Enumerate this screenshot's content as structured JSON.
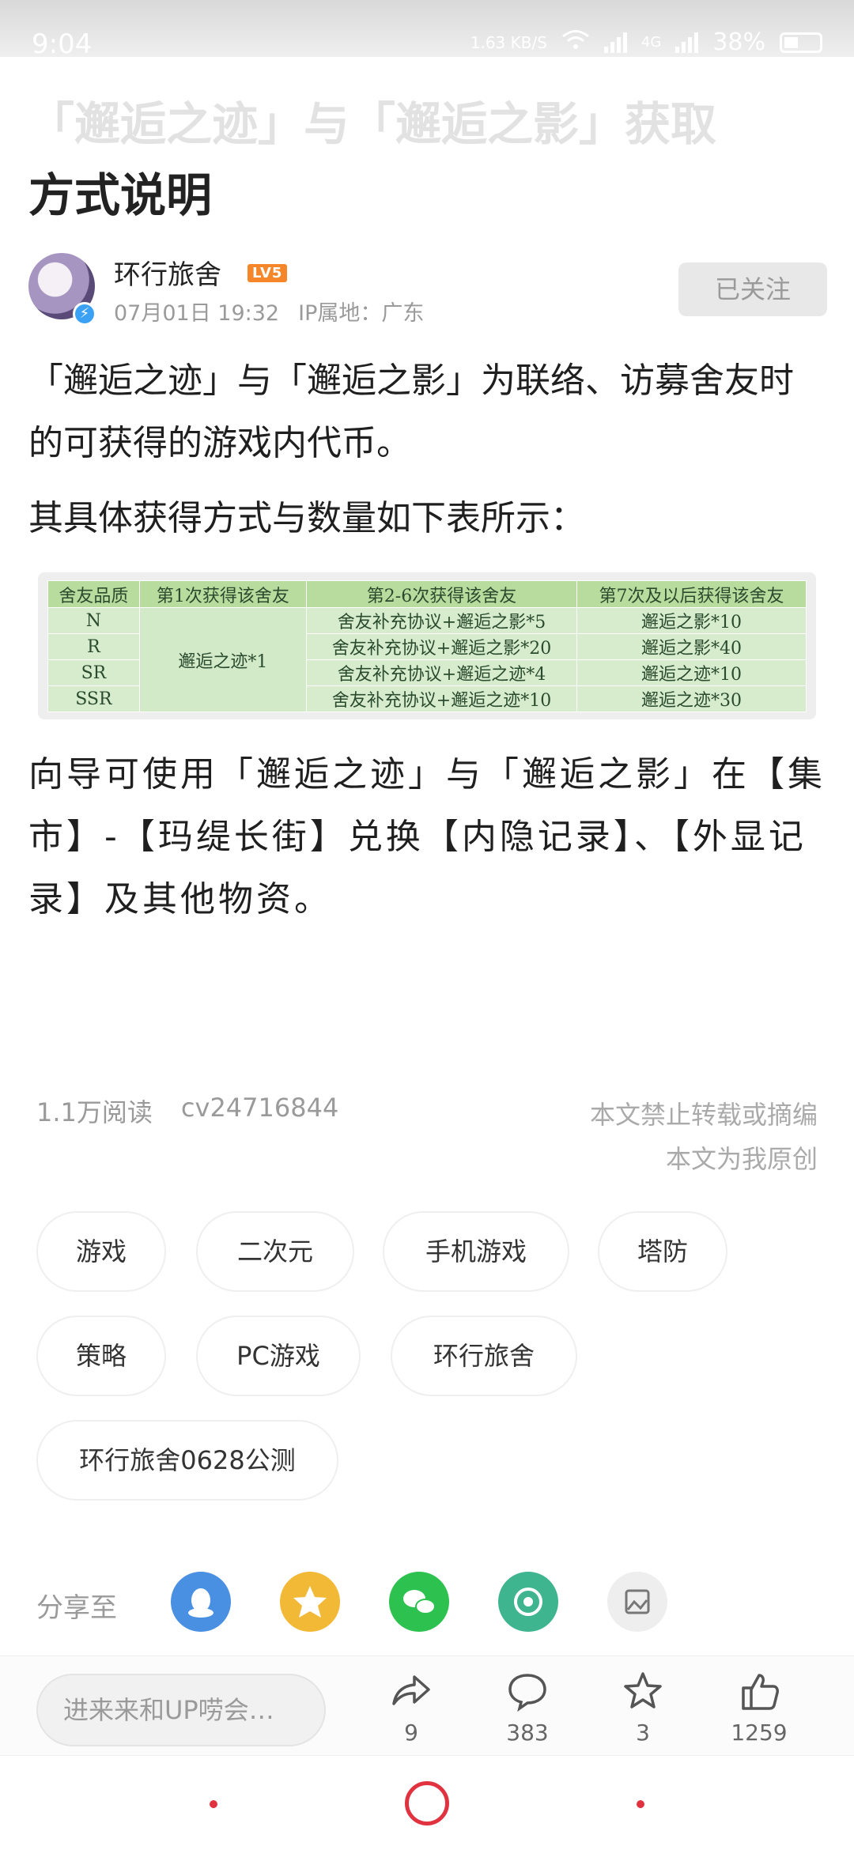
{
  "status_bar": {
    "time": "9:04",
    "speed": "1.63 KB/S",
    "network": "4G",
    "battery": "38%"
  },
  "article": {
    "title_line1": "「邂逅之迹」与「邂逅之影」获取",
    "title_line2": "方式说明",
    "author": {
      "name": "环行旅舍",
      "level": "LV5",
      "date": "07月01日 19:32",
      "ip": "IP属地：广东",
      "follow_label": "已关注"
    },
    "paragraph1": "「邂逅之迹」与「邂逅之影」为联络、访募舍友时的可获得的游戏内代币。",
    "paragraph2": "其具体获得方式与数量如下表所示：",
    "paragraph3": "向导可使用「邂逅之迹」与「邂逅之影」在【集市】-【玛缇长街】兑换【内隐记录】、【外显记录】及其他物资。"
  },
  "table": {
    "headers": [
      "舍友品质",
      "第1次获得该舍友",
      "第2-6次获得该舍友",
      "第7次及以后获得该舍友"
    ],
    "first_time": "邂逅之迹*1",
    "rows": [
      {
        "quality": "N",
        "repeat": "舍友补充协议+邂逅之影*5",
        "after": "邂逅之影*10"
      },
      {
        "quality": "R",
        "repeat": "舍友补充协议+邂逅之影*20",
        "after": "邂逅之影*40"
      },
      {
        "quality": "SR",
        "repeat": "舍友补充协议+邂逅之迹*4",
        "after": "邂逅之迹*10"
      },
      {
        "quality": "SSR",
        "repeat": "舍友补充协议+邂逅之迹*10",
        "after": "邂逅之迹*30"
      }
    ]
  },
  "stats": {
    "reads": "1.1万阅读",
    "cv": "cv24716844",
    "no_repost": "本文禁止转载或摘编",
    "original": "本文为我原创"
  },
  "tags": [
    "游戏",
    "二次元",
    "手机游戏",
    "塔防",
    "策略",
    "PC游戏",
    "环行旅舍",
    "环行旅舍0628公测"
  ],
  "share": {
    "label": "分享至",
    "targets": [
      "qq-icon",
      "qzone-icon",
      "wechat-icon",
      "moments-icon",
      "image-icon"
    ],
    "colors": [
      "#4a90e2",
      "#f2b937",
      "#2dc24f",
      "#3fb58f",
      "#eeeeee"
    ]
  },
  "action_bar": {
    "comment_placeholder": "进来来和UP唠会…",
    "share_count": "9",
    "comment_count": "383",
    "favorite_count": "3",
    "like_count": "1259"
  },
  "accent_color": "#e0323f"
}
